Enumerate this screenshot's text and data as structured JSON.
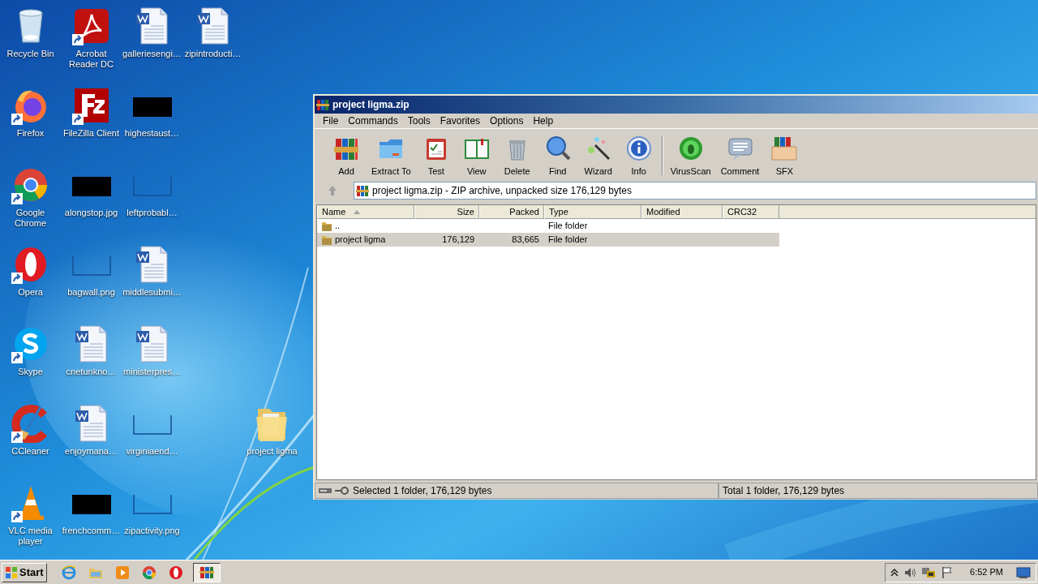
{
  "desktop": {
    "icons": [
      {
        "label": "Recycle Bin",
        "kind": "recycle",
        "shortcut": false
      },
      {
        "label": "Firefox",
        "kind": "firefox",
        "shortcut": true
      },
      {
        "label": "Google Chrome",
        "kind": "chrome",
        "shortcut": true
      },
      {
        "label": "Opera",
        "kind": "opera",
        "shortcut": true
      },
      {
        "label": "Skype",
        "kind": "skype",
        "shortcut": true
      },
      {
        "label": "CCleaner",
        "kind": "ccleaner",
        "shortcut": true
      },
      {
        "label": "VLC media player",
        "kind": "vlc",
        "shortcut": true
      },
      {
        "label": "Acrobat Reader DC",
        "kind": "acrobat",
        "shortcut": true
      },
      {
        "label": "FileZilla Client",
        "kind": "filezilla",
        "shortcut": true
      },
      {
        "label": "alongstop.jpg",
        "kind": "redacted",
        "shortcut": false
      },
      {
        "label": "bagwall.png",
        "kind": "blank",
        "shortcut": false
      },
      {
        "label": "cnetunkno…",
        "kind": "word",
        "shortcut": false
      },
      {
        "label": "enjoymana…",
        "kind": "word",
        "shortcut": false
      },
      {
        "label": "frenchcomm…",
        "kind": "redacted",
        "shortcut": false
      },
      {
        "label": "galleriesengi…",
        "kind": "word",
        "shortcut": false
      },
      {
        "label": "highestaust…",
        "kind": "redacted",
        "shortcut": false
      },
      {
        "label": "leftprobabl…",
        "kind": "blank",
        "shortcut": false
      },
      {
        "label": "middlesubmi…",
        "kind": "word",
        "shortcut": false
      },
      {
        "label": "ministerpres…",
        "kind": "word",
        "shortcut": false
      },
      {
        "label": "virginiaend…",
        "kind": "blank",
        "shortcut": false
      },
      {
        "label": "zipactivity.png",
        "kind": "blank",
        "shortcut": false
      },
      {
        "label": "zipintroducti…",
        "kind": "word",
        "shortcut": false
      }
    ],
    "loose_icon": {
      "label": "project ligma",
      "kind": "folder",
      "shortcut": false
    }
  },
  "window": {
    "title": "project ligma.zip",
    "menu": [
      "File",
      "Commands",
      "Tools",
      "Favorites",
      "Options",
      "Help"
    ],
    "toolbar": {
      "main": [
        {
          "label": "Add",
          "kind": "add"
        },
        {
          "label": "Extract To",
          "kind": "extract"
        },
        {
          "label": "Test",
          "kind": "test"
        },
        {
          "label": "View",
          "kind": "view"
        },
        {
          "label": "Delete",
          "kind": "delete"
        },
        {
          "label": "Find",
          "kind": "find"
        },
        {
          "label": "Wizard",
          "kind": "wizard"
        },
        {
          "label": "Info",
          "kind": "info"
        }
      ],
      "extra": [
        {
          "label": "VirusScan",
          "kind": "virus"
        },
        {
          "label": "Comment",
          "kind": "comment"
        },
        {
          "label": "SFX",
          "kind": "sfx"
        }
      ]
    },
    "address": "project ligma.zip - ZIP archive, unpacked size 176,129 bytes",
    "columns": [
      {
        "label": "Name",
        "sorted": true
      },
      {
        "label": "Size",
        "sorted": false
      },
      {
        "label": "Packed",
        "sorted": false
      },
      {
        "label": "Type",
        "sorted": false
      },
      {
        "label": "Modified",
        "sorted": false
      },
      {
        "label": "CRC32",
        "sorted": false
      }
    ],
    "rows": [
      {
        "name": "..",
        "type": "File folder",
        "selected": false
      },
      {
        "name": "project ligma",
        "size": "176,129",
        "packed": "83,665",
        "type": "File folder",
        "selected": true
      }
    ],
    "status_left": "Selected 1 folder, 176,129 bytes",
    "status_right": "Total 1 folder, 176,129 bytes"
  },
  "taskbar": {
    "start": "Start",
    "items": [
      {
        "kind": "ie",
        "selected": false
      },
      {
        "kind": "explorer",
        "selected": false
      },
      {
        "kind": "media",
        "selected": false
      },
      {
        "kind": "chrome",
        "selected": false
      },
      {
        "kind": "opera",
        "selected": false
      },
      {
        "kind": "winrar",
        "selected": true
      }
    ],
    "clock": "6:52 PM"
  }
}
